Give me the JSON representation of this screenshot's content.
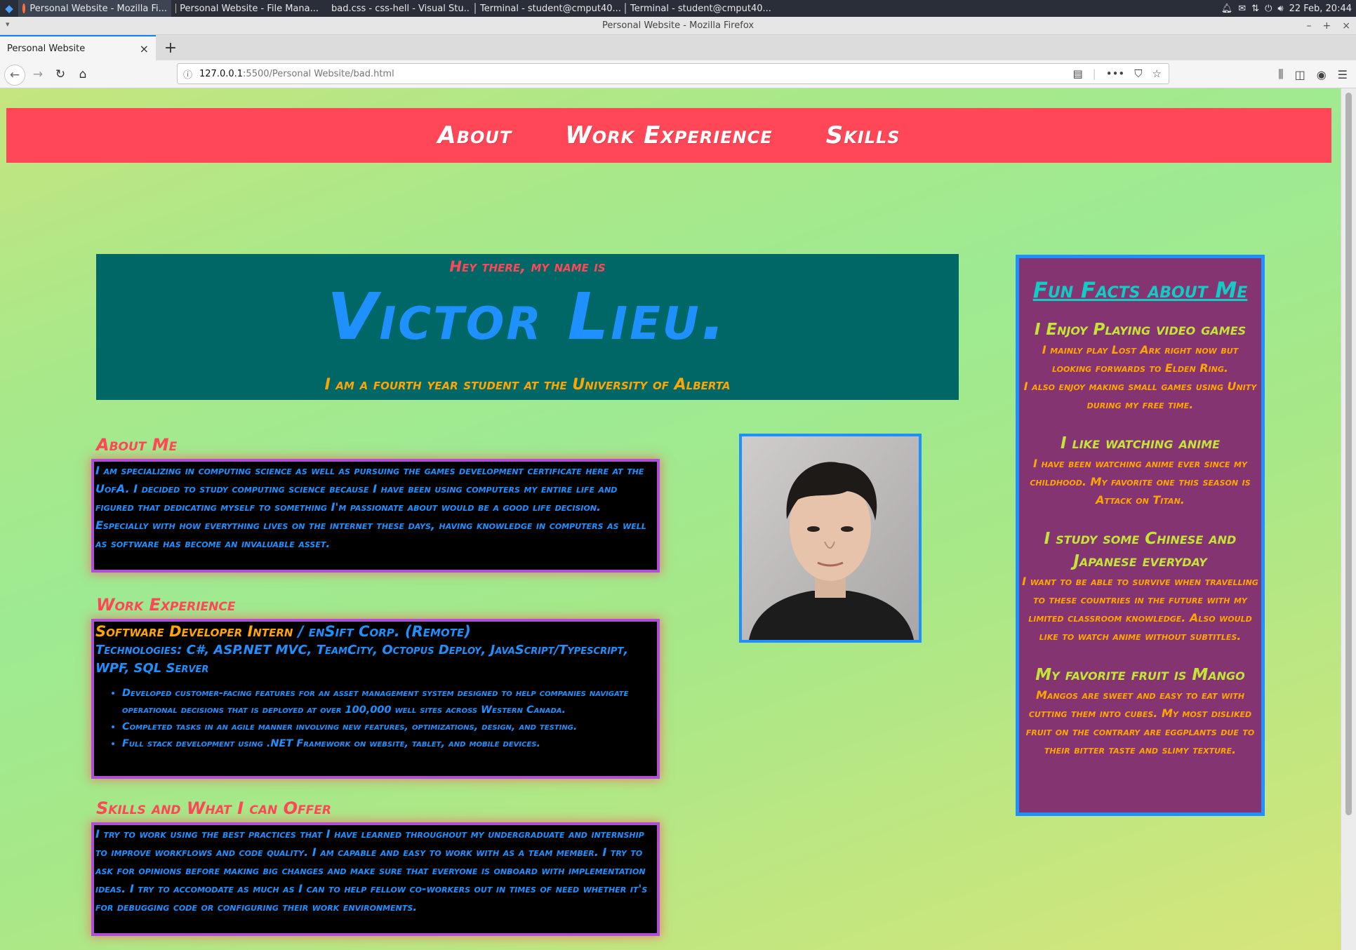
{
  "taskbar": {
    "tasks": [
      "Personal Website - Mozilla Fi...",
      "Personal Website - File Mana...",
      "bad.css - css-hell - Visual Stu...",
      "Terminal - student@cmput40...",
      "Terminal - student@cmput40..."
    ],
    "datetime": "22 Feb, 20:44"
  },
  "window": {
    "title": "Personal Website - Mozilla Firefox"
  },
  "browser": {
    "tab_title": "Personal Website",
    "url_host": "127.0.0.1",
    "url_path": ":5500/Personal Website/bad.html"
  },
  "nav": {
    "items": [
      "About",
      "Work Experience",
      "Skills"
    ]
  },
  "hero": {
    "greeting": "Hey there, my name is",
    "name": "Victor Lieu.",
    "subtitle": "I am a fourth year student at the University of Alberta"
  },
  "about": {
    "heading": "About Me",
    "text": "I am specializing in computing science as well as pursuing the games development certificate here at the UofA. I decided to study computing science because I have been using computers my entire life and figured that dedicating myself to something I'm passionate about would be a good life decision. Especially with how everything lives on the internet these days, having knowledge in computers as well as software has become an invaluable asset."
  },
  "work": {
    "heading": "Work Experience",
    "role": "Software Developer Intern",
    "company": " / enSift Corp. (Remote)",
    "tech": "Technologies: C#, ASP.NET MVC, TeamCity, Octopus Deploy, JavaScript/Typescript, WPF, SQL Server",
    "bullets": [
      "Developed customer-facing features for an asset management system designed to help companies navigate operational decisions that is deployed at over 100,000 well sites across Western Canada.",
      "Completed tasks in an agile manner involving new features, optimizations, design, and testing.",
      "Full stack development using .NET Framework on website, tablet, and mobile devices."
    ]
  },
  "skills": {
    "heading": "Skills and What I can Offer",
    "text": "I try to work using the best practices that I have learned throughout my undergraduate and internship to improve workflows and code quality. I am capable and easy to work with as a team member. I try to ask for opinions before making big changes and make sure that everyone is onboard with implementation ideas. I try to accomodate as much as I can to help fellow co-workers out in times of need whether it's for debugging code or configuring their work environments."
  },
  "facts": {
    "title": "Fun Facts about Me",
    "games_heading": "I Enjoy Playing video games",
    "games_text_1": "I mainly play Lost Ark right now but looking forwards to Elden Ring.",
    "games_text_2": "I also enjoy making small games using Unity during my free time.",
    "anime_heading": "I like watching anime",
    "anime_text": "I have been watching anime ever since my childhood. My favorite one this season is Attack on Titan.",
    "lang_heading": "I study some Chinese and Japanese everyday",
    "lang_text": "I want to be able to survive when travelling to these countries in the future with my limited classroom knowledge. Also would like to watch anime without subtitles.",
    "fruit_heading": "My favorite fruit is Mango",
    "fruit_text": "Mangos are sweet and easy to eat with cutting them into cubes. My most disliked fruit on the contrary are eggplants due to their bitter taste and slimy texture."
  }
}
